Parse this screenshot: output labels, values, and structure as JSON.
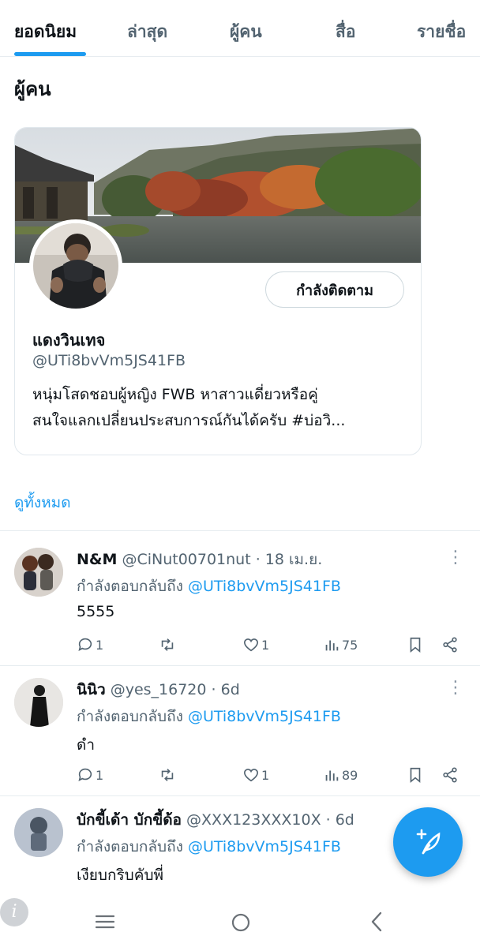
{
  "tabs": [
    {
      "label": "ยอดนิยม",
      "active": true
    },
    {
      "label": "ล่าสุด",
      "active": false
    },
    {
      "label": "ผู้คน",
      "active": false
    },
    {
      "label": "สื่อ",
      "active": false
    },
    {
      "label": "รายชื่อ",
      "active": false
    }
  ],
  "people_section": {
    "title": "ผู้คน",
    "see_all": "ดูทั้งหมด",
    "card": {
      "name": "แดงวินเทจ",
      "handle": "@UTi8bvVm5JS41FB",
      "bio_line1": "หนุ่มโสดชอบผู้หญิง FWB หาสาวแดี่ยวหรือคู่",
      "bio_line2": "สนใจแลกเปลี่ยนประสบการณ์กันได้ครับ #บ่อวิ...",
      "follow_label": "กำลังติดตาม"
    }
  },
  "posts": [
    {
      "name": "N&M",
      "handle": "@CiNut00701nut",
      "time": "· 18 เม.ย.",
      "reply_prefix": "กำลังตอบกลับถึง",
      "reply_to": "@UTi8bvVm5JS41FB",
      "text": "5555",
      "replies": "1",
      "retweets": "",
      "likes": "1",
      "views": "75"
    },
    {
      "name": "นินิว",
      "handle": "@yes_16720",
      "time": "· 6d",
      "reply_prefix": "กำลังตอบกลับถึง",
      "reply_to": "@UTi8bvVm5JS41FB",
      "text": "ดำ",
      "replies": "1",
      "retweets": "",
      "likes": "1",
      "views": "89"
    },
    {
      "name": "บักขี้เด้า บักขี้ด้อ",
      "handle": "@XXX123XXX10X",
      "time": "· 6d",
      "reply_prefix": "กำลังตอบกลับถึง",
      "reply_to": "@UTi8bvVm5JS41FB",
      "text": "เงียบกริบคับพี่"
    }
  ],
  "colors": {
    "accent": "#1d9bf0",
    "text_primary": "#0f1419",
    "text_secondary": "#536471",
    "border": "#e6ecf0"
  },
  "icons": {
    "compose": "feather-plus-icon",
    "reply": "speech-bubble-icon",
    "retweet": "retweet-icon",
    "like": "heart-icon",
    "views": "bar-chart-icon",
    "bookmark": "bookmark-icon",
    "share": "share-icon",
    "more": "vertical-dots-icon",
    "nav_recent": "menu-lines-icon",
    "nav_home": "circle-home-icon",
    "nav_back": "chevron-left-icon",
    "info": "info-icon"
  }
}
